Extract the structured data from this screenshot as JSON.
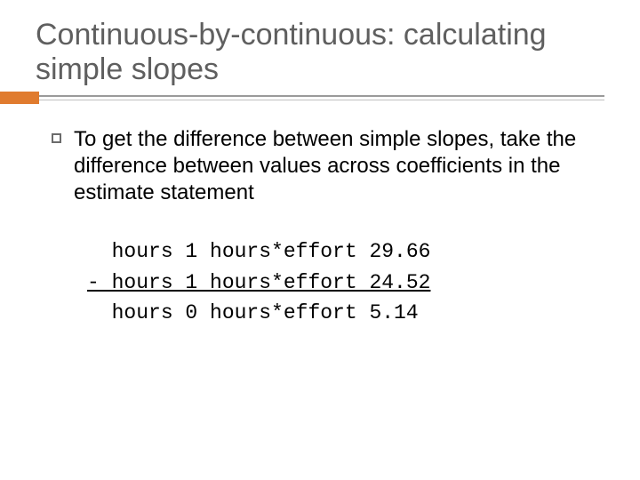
{
  "title": "Continuous-by-continuous: calculating simple slopes",
  "bullet": "To get the difference between simple slopes, take the difference between values across coefficients in the estimate statement",
  "code": {
    "line1": "  hours 1 hours*effort 29.66",
    "line2": "- hours 1 hours*effort 24.52",
    "line3": "  hours 0 hours*effort 5.14"
  }
}
